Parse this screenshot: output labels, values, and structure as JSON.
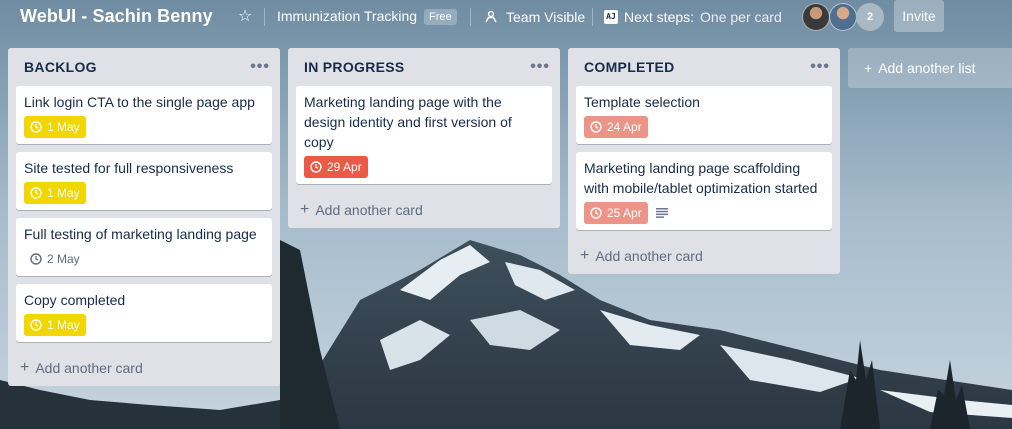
{
  "header": {
    "board_title": "WebUI - Sachin Benny",
    "team_name": "Immunization Tracking",
    "plan_badge": "Free",
    "visibility": "Team Visible",
    "next_steps_label": "Next steps:",
    "next_steps_value": "One per card",
    "app_icon_text": "AJ",
    "member_count": "2",
    "invite_label": "Invite"
  },
  "lists": [
    {
      "title": "BACKLOG",
      "menu": "•••",
      "add_card_label": "Add another card",
      "cards": [
        {
          "title": "Link login CTA to the single page app",
          "due": "1 May",
          "due_color": "yellow"
        },
        {
          "title": "Site tested for full responsiveness",
          "due": "1 May",
          "due_color": "yellow"
        },
        {
          "title": "Full testing of marketing landing page",
          "due": "2 May",
          "due_color": "none"
        },
        {
          "title": "Copy completed",
          "due": "1 May",
          "due_color": "yellow"
        }
      ]
    },
    {
      "title": "IN PROGRESS",
      "menu": "•••",
      "add_card_label": "Add another card",
      "cards": [
        {
          "title": "Marketing landing page with the design identity and first version of copy",
          "due": "29 Apr",
          "due_color": "red"
        }
      ]
    },
    {
      "title": "COMPLETED",
      "menu": "•••",
      "add_card_label": "Add another card",
      "cards": [
        {
          "title": "Template selection",
          "due": "24 Apr",
          "due_color": "light-red"
        },
        {
          "title": "Marketing landing page scaffolding with mobile/tablet optimization started",
          "due": "25 Apr",
          "due_color": "light-red",
          "has_description": true
        }
      ]
    }
  ],
  "add_list_label": "Add another list",
  "colors": {
    "list_bg": "#dfe1e6",
    "due_yellow": "#f2d600",
    "due_red": "#eb5a46",
    "due_light_red": "#ec9488",
    "text_primary": "#172b4d",
    "text_muted": "#5e6c84"
  },
  "icons": {
    "star": "star-icon",
    "visibility": "team-icon",
    "clock": "clock-icon",
    "description": "description-icon",
    "plus": "plus-icon",
    "menu": "more-icon"
  }
}
